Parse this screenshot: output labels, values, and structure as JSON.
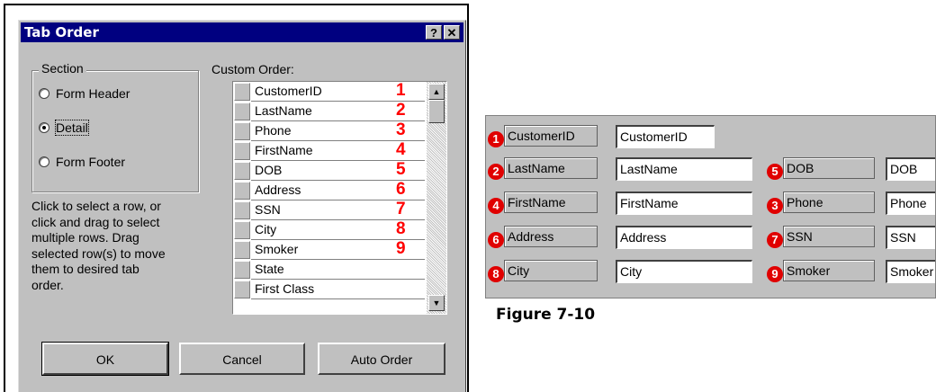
{
  "dialog": {
    "title": "Tab Order",
    "help_button": "?",
    "close_button": "✕",
    "section": {
      "label": "Section",
      "options": [
        "Form Header",
        "Detail",
        "Form Footer"
      ],
      "selected": "Detail"
    },
    "help_text": "Click to select a row, or\nclick and drag to select\nmultiple rows.  Drag\nselected row(s) to move\nthem to desired tab\norder.",
    "custom_order_label": "Custom Order:",
    "rows": [
      {
        "name": "CustomerID",
        "num": "1"
      },
      {
        "name": "LastName",
        "num": "2"
      },
      {
        "name": "Phone",
        "num": "3"
      },
      {
        "name": "FirstName",
        "num": "4"
      },
      {
        "name": "DOB",
        "num": "5"
      },
      {
        "name": "Address",
        "num": "6"
      },
      {
        "name": "SSN",
        "num": "7"
      },
      {
        "name": "City",
        "num": "8"
      },
      {
        "name": "Smoker",
        "num": "9"
      },
      {
        "name": "State",
        "num": ""
      },
      {
        "name": "First Class",
        "num": ""
      }
    ],
    "buttons": {
      "ok": "OK",
      "cancel": "Cancel",
      "auto_order": "Auto Order"
    }
  },
  "figure": {
    "caption": "Figure 7-10",
    "controls": [
      {
        "badge": "1",
        "label": "CustomerID",
        "field": "CustomerID"
      },
      {
        "badge": "2",
        "label": "LastName",
        "field": "LastName"
      },
      {
        "badge": "4",
        "label": "FirstName",
        "field": "FirstName"
      },
      {
        "badge": "6",
        "label": "Address",
        "field": "Address"
      },
      {
        "badge": "8",
        "label": "City",
        "field": "City"
      },
      {
        "badge": "5",
        "label": "DOB",
        "field": "DOB"
      },
      {
        "badge": "3",
        "label": "Phone",
        "field": "Phone"
      },
      {
        "badge": "7",
        "label": "SSN",
        "field": "SSN"
      },
      {
        "badge": "9",
        "label": "Smoker",
        "field": "Smoker"
      }
    ]
  },
  "colors": {
    "title_bar": "#000080",
    "badge": "#e00000",
    "order_number": "#ff0000"
  }
}
